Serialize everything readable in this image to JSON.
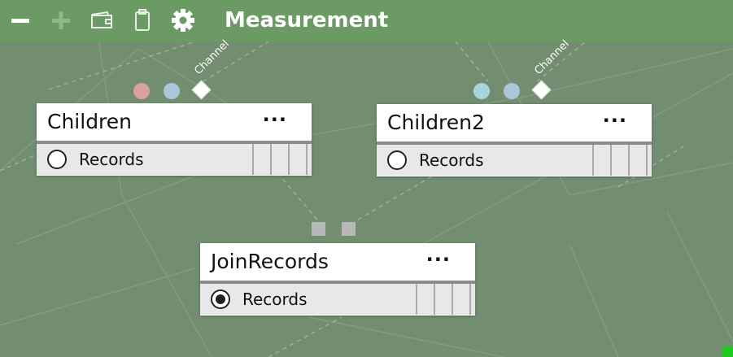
{
  "toolbar": {
    "title": "Measurement",
    "icons": [
      "minus-icon",
      "plus-icon",
      "wallet-icon",
      "clipboard-icon",
      "gear-icon"
    ]
  },
  "nodes": {
    "children": {
      "title": "Children",
      "menu": "···",
      "port_label": "Records",
      "channel_label": "Channel"
    },
    "children2": {
      "title": "Children2",
      "menu": "···",
      "port_label": "Records",
      "channel_label": "Channel"
    },
    "join": {
      "title": "JoinRecords",
      "menu": "···",
      "port_label": "Records"
    }
  },
  "colors": {
    "canvas": "#728d6f",
    "toolbar": "#6c9a64",
    "dot_red": "#d9a1a2",
    "dot_blue": "#a8c8d9",
    "dot_teal": "#a9d6db",
    "status_green": "#1ec81e"
  }
}
